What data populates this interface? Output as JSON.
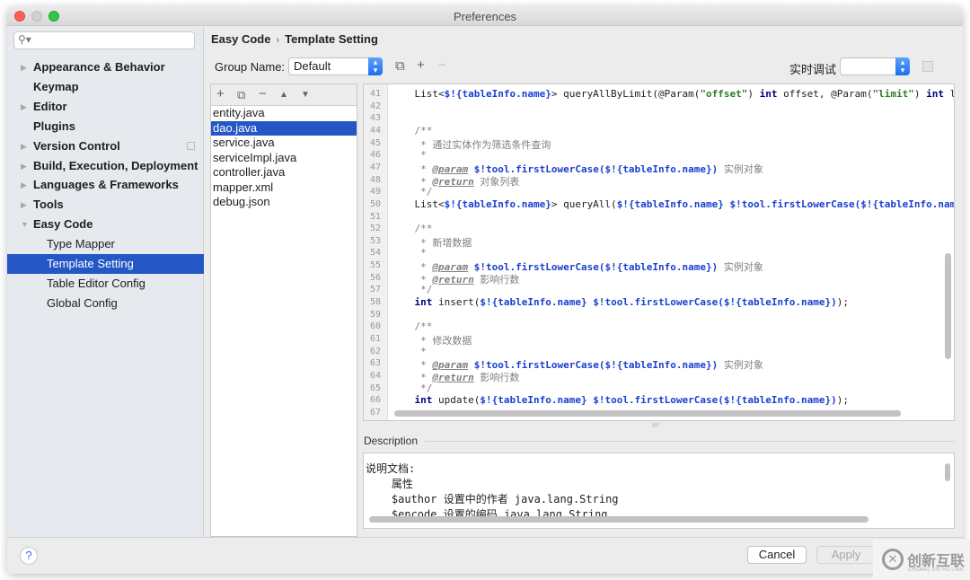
{
  "window": {
    "title": "Preferences"
  },
  "sidebar": {
    "search_placeholder": "",
    "items": [
      {
        "label": "Appearance & Behavior",
        "expandable": true,
        "expanded": false,
        "level": 0
      },
      {
        "label": "Keymap",
        "expandable": false,
        "level": 0
      },
      {
        "label": "Editor",
        "expandable": true,
        "expanded": false,
        "level": 0
      },
      {
        "label": "Plugins",
        "expandable": false,
        "level": 0
      },
      {
        "label": "Version Control",
        "expandable": true,
        "expanded": false,
        "level": 0
      },
      {
        "label": "Build, Execution, Deployment",
        "expandable": true,
        "expanded": false,
        "level": 0
      },
      {
        "label": "Languages & Frameworks",
        "expandable": true,
        "expanded": false,
        "level": 0
      },
      {
        "label": "Tools",
        "expandable": true,
        "expanded": false,
        "level": 0
      },
      {
        "label": "Easy Code",
        "expandable": true,
        "expanded": true,
        "level": 0
      },
      {
        "label": "Type Mapper",
        "level": 1
      },
      {
        "label": "Template Setting",
        "level": 1,
        "selected": true
      },
      {
        "label": "Table Editor Config",
        "level": 1
      },
      {
        "label": "Global Config",
        "level": 1
      }
    ]
  },
  "breadcrumb": {
    "parent": "Easy Code",
    "separator": "›",
    "current": "Template Setting"
  },
  "group": {
    "label": "Group Name:",
    "value": "Default"
  },
  "debug": {
    "label": "实时调试",
    "value": ""
  },
  "file_list": {
    "toolbar": [
      "add",
      "copy",
      "remove",
      "move-up",
      "move-down"
    ],
    "files": [
      "entity.java",
      "dao.java",
      "service.java",
      "serviceImpl.java",
      "controller.java",
      "mapper.xml",
      "debug.json"
    ],
    "selected": "dao.java"
  },
  "editor": {
    "partial_top_line": "40",
    "lines": [
      {
        "n": "41",
        "html": "    List&lt;<span class='var'>$!{tableInfo.name}</span>&gt; queryAllByLimit(@Param(<span class='str'>\"offset\"</span>) <span class='kw'>int</span> offset, @Param(<span class='str'>\"limit\"</span>) <span class='kw'>int</span> li"
      },
      {
        "n": "42",
        "html": ""
      },
      {
        "n": "43",
        "html": ""
      },
      {
        "n": "44",
        "html": "    <span class='cmt'>/**</span>"
      },
      {
        "n": "45",
        "html": "    <span class='cmt'> * 通过实体作为筛选条件查询</span>"
      },
      {
        "n": "46",
        "html": "    <span class='cmt'> *</span>"
      },
      {
        "n": "47",
        "html": "    <span class='cmt'> * </span><span class='tag'>@param</span> <span class='var'>$!tool.firstLowerCase($!{tableInfo.name})</span><span class='cmt'> 实例对象</span>"
      },
      {
        "n": "48",
        "html": "    <span class='cmt'> * </span><span class='tag'>@return</span><span class='cmt'> 对象列表</span>"
      },
      {
        "n": "49",
        "html": "    <span class='cmt'> */</span>"
      },
      {
        "n": "50",
        "html": "    List&lt;<span class='var'>$!{tableInfo.name}</span>&gt; queryAll(<span class='var'>$!{tableInfo.name}</span> <span class='var'>$!tool.firstLowerCase($!{tableInfo.name</span>"
      },
      {
        "n": "51",
        "html": ""
      },
      {
        "n": "52",
        "html": "    <span class='cmt'>/**</span>"
      },
      {
        "n": "53",
        "html": "    <span class='cmt'> * 新增数据</span>"
      },
      {
        "n": "54",
        "html": "    <span class='cmt'> *</span>"
      },
      {
        "n": "55",
        "html": "    <span class='cmt'> * </span><span class='tag'>@param</span> <span class='var'>$!tool.firstLowerCase($!{tableInfo.name})</span><span class='cmt'> 实例对象</span>"
      },
      {
        "n": "56",
        "html": "    <span class='cmt'> * </span><span class='tag'>@return</span><span class='cmt'> 影响行数</span>"
      },
      {
        "n": "57",
        "html": "    <span class='cmt'> */</span>"
      },
      {
        "n": "58",
        "html": "    <span class='kw'>int</span> insert(<span class='var'>$!{tableInfo.name}</span> <span class='var'>$!tool.firstLowerCase($!{tableInfo.name})</span>);"
      },
      {
        "n": "59",
        "html": ""
      },
      {
        "n": "60",
        "html": "    <span class='cmt'>/**</span>"
      },
      {
        "n": "61",
        "html": "    <span class='cmt'> * 修改数据</span>"
      },
      {
        "n": "62",
        "html": "    <span class='cmt'> *</span>"
      },
      {
        "n": "63",
        "html": "    <span class='cmt'> * </span><span class='tag'>@param</span> <span class='var'>$!tool.firstLowerCase($!{tableInfo.name})</span><span class='cmt'> 实例对象</span>"
      },
      {
        "n": "64",
        "html": "    <span class='cmt'> * </span><span class='tag'>@return</span><span class='cmt'> 影响行数</span>"
      },
      {
        "n": "65",
        "html": "    <span class='cmt'> */</span>"
      },
      {
        "n": "66",
        "html": "    <span class='kw'>int</span> update(<span class='var'>$!{tableInfo.name}</span> <span class='var'>$!tool.firstLowerCase($!{tableInfo.name})</span>);"
      },
      {
        "n": "67",
        "html": ""
      }
    ]
  },
  "description": {
    "label": "Description",
    "lines": [
      "说明文档:",
      "    属性",
      "    $author 设置中的作者 java.lang.String",
      "    $encode 设置的编码 java.lang.String"
    ]
  },
  "footer": {
    "help": "?",
    "cancel": "Cancel",
    "apply": "Apply"
  },
  "watermark": {
    "text": "创新互联",
    "sub": "CHUANG XIN HU LIAN"
  }
}
